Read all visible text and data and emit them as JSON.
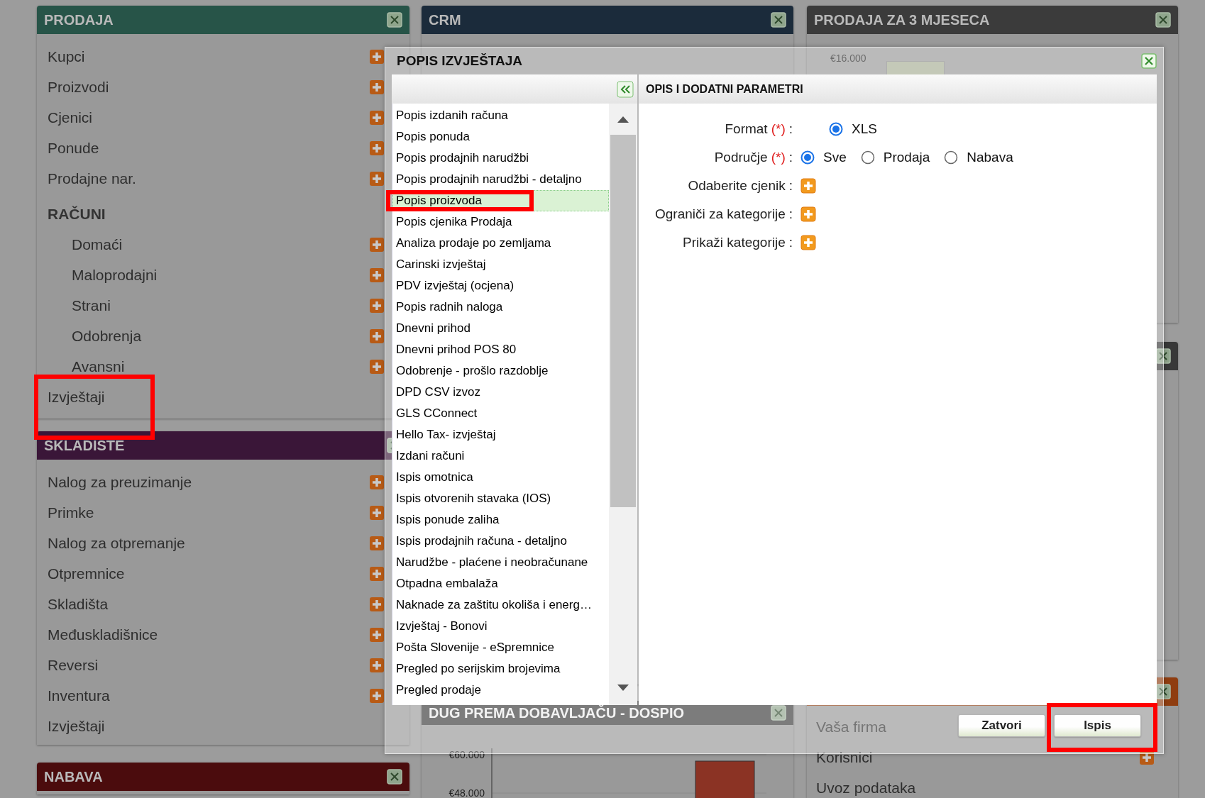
{
  "columns": [
    {
      "panels": [
        {
          "title": "PRODAJA",
          "color": "#275448",
          "items": [
            {
              "label": "Kupci",
              "kind": "link",
              "add_button": true,
              "highlighted": false
            },
            {
              "label": "Proizvodi",
              "kind": "link",
              "add_button": true,
              "highlighted": false
            },
            {
              "label": "Cjenici",
              "kind": "link",
              "add_button": true,
              "highlighted": false
            },
            {
              "label": "Ponude",
              "kind": "link",
              "add_button": true,
              "highlighted": false
            },
            {
              "label": "Prodajne nar.",
              "kind": "link",
              "add_button": true,
              "highlighted": false
            },
            {
              "label": "RAČUNI",
              "kind": "heading",
              "add_button": false,
              "highlighted": false
            },
            {
              "label": "Domaći",
              "kind": "subitem",
              "add_button": true,
              "highlighted": false
            },
            {
              "label": "Maloprodajni",
              "kind": "subitem",
              "add_button": true,
              "highlighted": false
            },
            {
              "label": "Strani",
              "kind": "subitem",
              "add_button": true,
              "highlighted": false
            },
            {
              "label": "Odobrenja",
              "kind": "subitem",
              "add_button": true,
              "highlighted": false
            },
            {
              "label": "Avansni",
              "kind": "subitem",
              "add_button": true,
              "highlighted": false
            },
            {
              "label": "Izvještaji",
              "kind": "link",
              "add_button": false,
              "highlighted": true
            }
          ]
        },
        {
          "title": "SKLADISTE",
          "color": "#3a1638",
          "items": [
            {
              "label": "Nalog za preuzimanje",
              "kind": "link",
              "add_button": true,
              "highlighted": false
            },
            {
              "label": "Primke",
              "kind": "link",
              "add_button": true,
              "highlighted": false
            },
            {
              "label": "Nalog za otpremanje",
              "kind": "link",
              "add_button": true,
              "highlighted": false
            },
            {
              "label": "Otpremnice",
              "kind": "link",
              "add_button": true,
              "highlighted": false
            },
            {
              "label": "Skladišta",
              "kind": "link",
              "add_button": true,
              "highlighted": false
            },
            {
              "label": "Međuskladišnice",
              "kind": "link",
              "add_button": true,
              "highlighted": false
            },
            {
              "label": "Reversi",
              "kind": "link",
              "add_button": true,
              "highlighted": false
            },
            {
              "label": "Inventura",
              "kind": "link",
              "add_button": true,
              "highlighted": false
            },
            {
              "label": "Izvještaji",
              "kind": "link",
              "add_button": false,
              "highlighted": false
            }
          ]
        },
        {
          "title": "NABAVA",
          "color": "#4b0c0d"
        }
      ]
    },
    {
      "panels": [
        {
          "title": "CRM",
          "color": "#1b2b3b"
        },
        {
          "title": "DUG PREMA DOBAVLJAČU - DOSPIO",
          "chart_data": {
            "type": "bar",
            "values": [
              58000
            ],
            "ylim": [
              46000,
              62000
            ],
            "yticks": [
              {
                "value": 48000,
                "label": "€48.000"
              },
              {
                "value": 60000,
                "label": "€60.000"
              }
            ]
          }
        }
      ]
    },
    {
      "panels": [
        {
          "title": "PRODAJA ZA 3 MJESECA",
          "color": "#3b3b3b",
          "tick_label": "€16.000"
        },
        {
          "color": "#383838"
        },
        {
          "color": "#8f3d10",
          "items": [
            {
              "label": "Vaša firma",
              "kind": "link",
              "add_button": false,
              "highlighted": false
            },
            {
              "label": "Korisnici",
              "kind": "link",
              "add_button": true,
              "highlighted": false
            },
            {
              "label": "Uvoz podataka",
              "kind": "link",
              "add_button": false,
              "highlighted": false
            }
          ]
        }
      ]
    }
  ],
  "dialog": {
    "title": "POPIS IZVJEŠTAJA",
    "details_title": "OPIS I DODATNI PARAMETRI",
    "reports": [
      {
        "label": "Popis izdanih računa",
        "selected": false,
        "highlighted": false
      },
      {
        "label": "Popis ponuda",
        "selected": false,
        "highlighted": false
      },
      {
        "label": "Popis prodajnih narudžbi",
        "selected": false,
        "highlighted": false
      },
      {
        "label": "Popis prodajnih narudžbi - detaljno",
        "selected": false,
        "highlighted": false
      },
      {
        "label": "Popis proizvoda",
        "selected": true,
        "highlighted": true
      },
      {
        "label": "Popis cjenika Prodaja",
        "selected": false,
        "highlighted": false
      },
      {
        "label": "Analiza prodaje po zemljama",
        "selected": false,
        "highlighted": false
      },
      {
        "label": "Carinski izvještaj",
        "selected": false,
        "highlighted": false
      },
      {
        "label": "PDV izvještaj (ocjena)",
        "selected": false,
        "highlighted": false
      },
      {
        "label": "Popis radnih naloga",
        "selected": false,
        "highlighted": false
      },
      {
        "label": "Dnevni prihod",
        "selected": false,
        "highlighted": false
      },
      {
        "label": "Dnevni prihod POS 80",
        "selected": false,
        "highlighted": false
      },
      {
        "label": "Odobrenje - prošlo razdoblje",
        "selected": false,
        "highlighted": false
      },
      {
        "label": "DPD CSV izvoz",
        "selected": false,
        "highlighted": false
      },
      {
        "label": "GLS CConnect",
        "selected": false,
        "highlighted": false
      },
      {
        "label": "Hello Tax- izvještaj",
        "selected": false,
        "highlighted": false
      },
      {
        "label": "Izdani računi",
        "selected": false,
        "highlighted": false
      },
      {
        "label": "Ispis omotnica",
        "selected": false,
        "highlighted": false
      },
      {
        "label": "Ispis otvorenih stavaka (IOS)",
        "selected": false,
        "highlighted": false
      },
      {
        "label": "Ispis ponude zaliha",
        "selected": false,
        "highlighted": false
      },
      {
        "label": "Ispis prodajnih računa - detaljno",
        "selected": false,
        "highlighted": false
      },
      {
        "label": "Narudžbe - plaćene i neobračunane",
        "selected": false,
        "highlighted": false
      },
      {
        "label": "Otpadna embalaža",
        "selected": false,
        "highlighted": false
      },
      {
        "label": "Naknade za zaštitu okoliša i energ…",
        "selected": false,
        "highlighted": false
      },
      {
        "label": "Izvještaj - Bonovi",
        "selected": false,
        "highlighted": false
      },
      {
        "label": "Pošta Slovenije - eSpremnice",
        "selected": false,
        "highlighted": false
      },
      {
        "label": "Pregled po serijskim brojevima",
        "selected": false,
        "highlighted": false
      },
      {
        "label": "Pregled prodaje",
        "selected": false,
        "highlighted": false
      }
    ],
    "fields": [
      {
        "label": "Format",
        "required_mark": "(*)",
        "suffix": ":",
        "kind": "radio",
        "options": [
          {
            "label": "XLS",
            "selected": true
          }
        ]
      },
      {
        "label": "Područje",
        "required_mark": "(*)",
        "suffix": ":",
        "kind": "radio",
        "options": [
          {
            "label": "Sve",
            "selected": true
          },
          {
            "label": "Prodaja",
            "selected": false
          },
          {
            "label": "Nabava",
            "selected": false
          }
        ]
      },
      {
        "label": "Odaberite cjenik",
        "suffix": ":",
        "kind": "add"
      },
      {
        "label": "Ograniči za kategorije",
        "suffix": ":",
        "kind": "add"
      },
      {
        "label": "Prikaži kategorije",
        "suffix": ":",
        "kind": "add"
      }
    ],
    "buttons": [
      {
        "label": "Zatvori",
        "highlighted": false
      },
      {
        "label": "Ispis",
        "highlighted": true
      }
    ]
  }
}
